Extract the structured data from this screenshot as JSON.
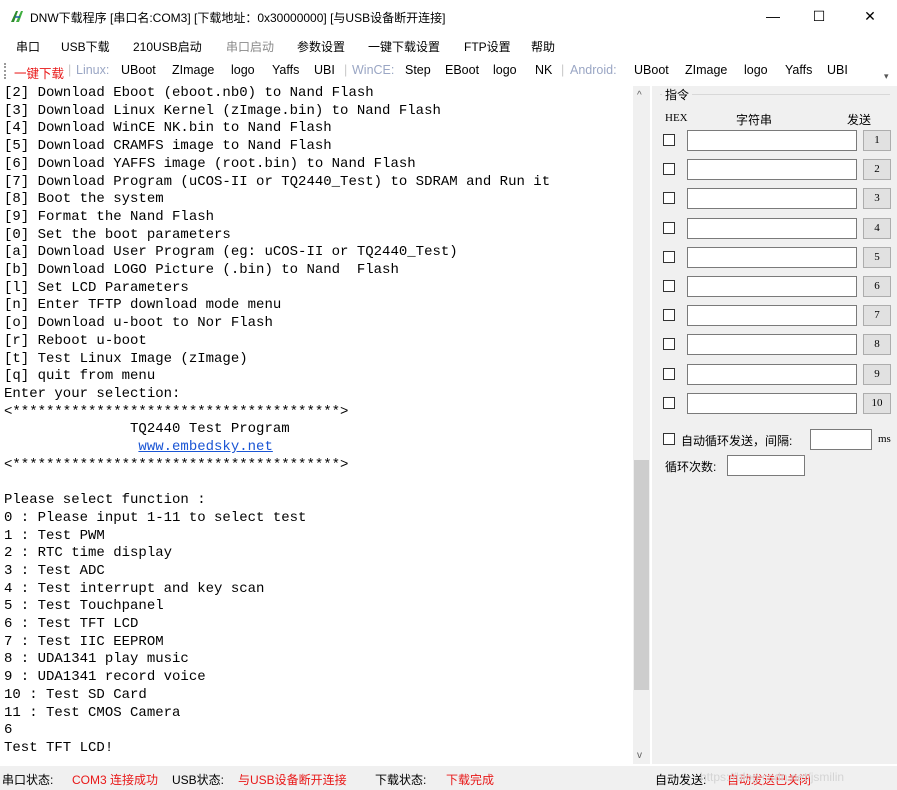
{
  "window": {
    "title": "DNW下载程序 [串口名:COM3] [下载地址：0x30000000]  [与USB设备断开连接]",
    "minimize_glyph": "—",
    "maximize_glyph": "☐",
    "close_glyph": "✕"
  },
  "menu": {
    "items": [
      "串口",
      "USB下载",
      "210USB启动",
      "串口启动",
      "参数设置",
      "一键下载设置",
      "FTP设置",
      "帮助"
    ]
  },
  "toolbar": {
    "one_click": "一键下载",
    "linux_label": "Linux:",
    "linux_items": [
      "UBoot",
      "ZImage",
      "logo",
      "Yaffs",
      "UBI"
    ],
    "wince_label": "WinCE:",
    "wince_items": [
      "Step",
      "EBoot",
      "logo",
      "NK"
    ],
    "android_label": "Android:",
    "android_items": [
      "UBoot",
      "ZImage",
      "logo",
      "Yaffs",
      "UBI"
    ],
    "separator": "|"
  },
  "terminal": {
    "lines": [
      "[2] Download Eboot (eboot.nb0) to Nand Flash",
      "[3] Download Linux Kernel (zImage.bin) to Nand Flash",
      "[4] Download WinCE NK.bin to Nand Flash",
      "[5] Download CRAMFS image to Nand Flash",
      "[6] Download YAFFS image (root.bin) to Nand Flash",
      "[7] Download Program (uCOS-II or TQ2440_Test) to SDRAM and Run it",
      "[8] Boot the system",
      "[9] Format the Nand Flash",
      "[0] Set the boot parameters",
      "[a] Download User Program (eg: uCOS-II or TQ2440_Test)",
      "[b] Download LOGO Picture (.bin) to Nand  Flash",
      "[l] Set LCD Parameters",
      "[n] Enter TFTP download mode menu",
      "[o] Download u-boot to Nor Flash",
      "[r] Reboot u-boot",
      "[t] Test Linux Image (zImage)",
      "[q] quit from menu",
      "Enter your selection:",
      "<***************************************>",
      "               TQ2440 Test Program",
      "",
      "<***************************************>",
      "",
      "Please select function :",
      "0 : Please input 1-11 to select test",
      "1 : Test PWM",
      "2 : RTC time display",
      "3 : Test ADC",
      "4 : Test interrupt and key scan",
      "5 : Test Touchpanel",
      "6 : Test TFT LCD",
      "7 : Test IIC EEPROM",
      "8 : UDA1341 play music",
      "9 : UDA1341 record voice",
      "10 : Test SD Card",
      "11 : Test CMOS Camera",
      "6",
      "Test TFT LCD!"
    ],
    "link_indent": "                ",
    "link_text": "www.embedsky.net"
  },
  "command_panel": {
    "group_title": "指令",
    "hex_header": "HEX",
    "string_header": "字符串",
    "send_header": "发送",
    "rows": [
      {
        "button": "1",
        "value": ""
      },
      {
        "button": "2",
        "value": ""
      },
      {
        "button": "3",
        "value": ""
      },
      {
        "button": "4",
        "value": ""
      },
      {
        "button": "5",
        "value": ""
      },
      {
        "button": "6",
        "value": ""
      },
      {
        "button": "7",
        "value": ""
      },
      {
        "button": "8",
        "value": ""
      },
      {
        "button": "9",
        "value": ""
      },
      {
        "button": "10",
        "value": ""
      }
    ],
    "auto_loop_label": "自动循环发送，间隔:",
    "interval_value": "",
    "ms_unit": "ms",
    "loop_count_label": "循环次数:",
    "loop_count_value": ""
  },
  "statusbar": {
    "serial_label": "串口状态:",
    "serial_value": "COM3 连接成功",
    "usb_label": "USB状态:",
    "usb_value": "与USB设备断开连接",
    "download_label": "下载状态:",
    "download_value": "下载完成",
    "auto_send_label": "自动发送:",
    "auto_send_value": "自动发送已关闭",
    "watermark": "https://blog.csdn.net/jsmilin"
  },
  "colors": {
    "red": "#e81818",
    "link": "#1a55d4",
    "panel_bg": "#f0f0f0"
  }
}
